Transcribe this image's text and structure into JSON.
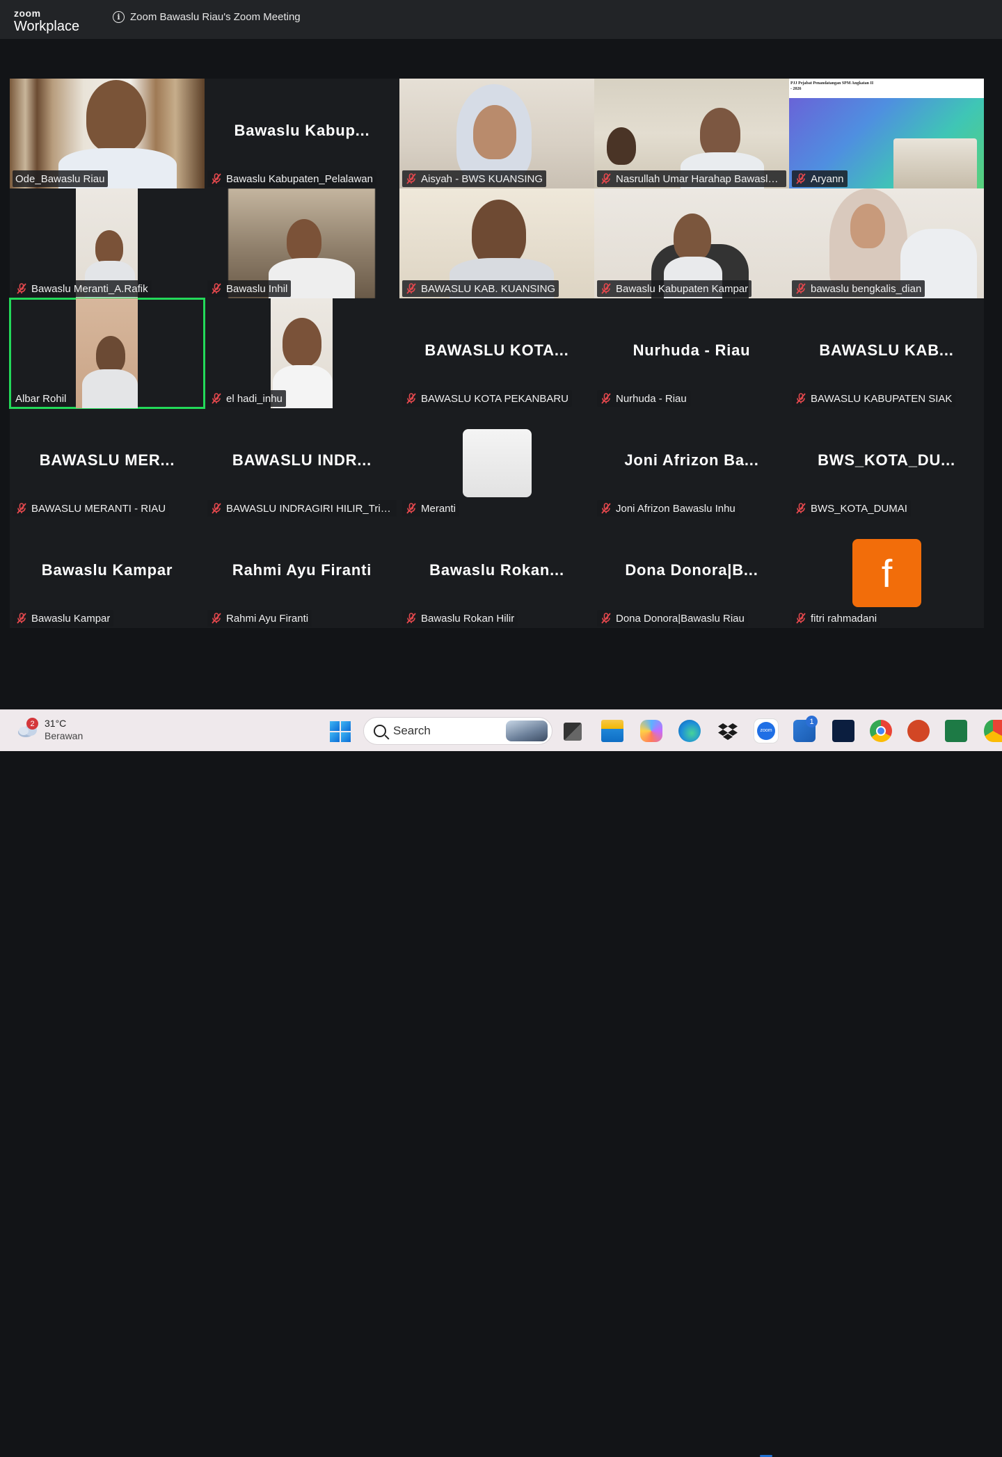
{
  "app": {
    "brand_top": "zoom",
    "brand_bottom": "Workplace",
    "meeting_title": "Zoom Bawaslu Riau's Zoom Meeting"
  },
  "tiles": [
    {
      "name": "Ode_Bawaslu Riau",
      "muted": false
    },
    {
      "name": "Bawaslu Kabupaten_Pelalawan",
      "big": "Bawaslu  Kabup...",
      "muted": true
    },
    {
      "name": "Aisyah - BWS KUANSING",
      "muted": true
    },
    {
      "name": "Nasrullah Umar Harahap Bawaslu ...",
      "muted": true
    },
    {
      "name": "Aryann",
      "muted": true,
      "slide_text": "PJJ Pejabat Penandatangan SPM Angkatan II - 2026"
    },
    {
      "name": "Bawaslu Meranti_A.Rafik",
      "muted": true
    },
    {
      "name": "Bawaslu Inhil",
      "muted": true
    },
    {
      "name": "BAWASLU KAB. KUANSING",
      "muted": true
    },
    {
      "name": "Bawaslu Kabupaten Kampar",
      "muted": true
    },
    {
      "name": "bawaslu bengkalis_dian",
      "muted": true
    },
    {
      "name": "Albar Rohil",
      "muted": false,
      "active": true
    },
    {
      "name": "el hadi_inhu",
      "muted": true
    },
    {
      "name": "BAWASLU KOTA PEKANBARU",
      "big": "BAWASLU  KOTA...",
      "muted": true
    },
    {
      "name": "Nurhuda - Riau",
      "big": "Nurhuda - Riau",
      "muted": true
    },
    {
      "name": "BAWASLU KABUPATEN SIAK",
      "big": "BAWASLU  KAB...",
      "muted": true
    },
    {
      "name": "BAWASLU MERANTI - RIAU",
      "big": "BAWASLU  MER...",
      "muted": true
    },
    {
      "name": "BAWASLU INDRAGIRI HILIR_Tri Ga...",
      "big": "BAWASLU  INDR...",
      "muted": true
    },
    {
      "name": "Meranti",
      "muted": true
    },
    {
      "name": "Joni Afrizon Bawaslu Inhu",
      "big": "Joni  Afrizon  Ba...",
      "muted": true
    },
    {
      "name": "BWS_KOTA_DUMAI",
      "big": "BWS_KOTA_DU...",
      "muted": true
    },
    {
      "name": "Bawaslu Kampar",
      "big": "Bawaslu  Kampar",
      "muted": true
    },
    {
      "name": "Rahmi Ayu Firanti",
      "big": "Rahmi  Ayu  Firanti",
      "muted": true
    },
    {
      "name": "Bawaslu Rokan Hilir",
      "big": "Bawaslu  Rokan...",
      "muted": true
    },
    {
      "name": "Dona Donora|Bawaslu Riau",
      "big": "Dona  Donora|B...",
      "muted": true
    },
    {
      "name": "fitri rahmadani",
      "avatar_letter": "f",
      "muted": true
    }
  ],
  "taskbar": {
    "weather_temp": "31°C",
    "weather_cond": "Berawan",
    "weather_badge": "2",
    "search_label": "Search",
    "store_badge": "1"
  },
  "colors": {
    "active_speaker": "#23d959",
    "muted_red": "#e5484d",
    "avatar_orange": "#f26d0a"
  }
}
